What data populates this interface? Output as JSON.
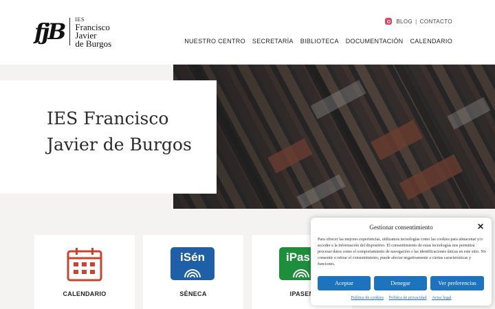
{
  "header": {
    "logo_mark": "fjB",
    "logo_small": "IES",
    "logo_line1": "Francisco",
    "logo_line2": "Javier",
    "logo_line3": "de Burgos",
    "top_links": {
      "blog": "BLOG",
      "separator": "|",
      "contact": "CONTACTO"
    },
    "nav": [
      "NUESTRO CENTRO",
      "SECRETARÍA",
      "BIBLIOTECA",
      "DOCUMENTACIÓN",
      "CALENDARIO"
    ]
  },
  "hero": {
    "title_line1": "IES Francisco",
    "title_line2": "Javier de Burgos"
  },
  "cards": [
    {
      "label": "CALENDARIO",
      "icon": "calendar-icon"
    },
    {
      "label": "SÉNECA",
      "icon_text": "iSén"
    },
    {
      "label": "IPASEN",
      "icon_text": "iPas"
    }
  ],
  "consent": {
    "title": "Gestionar consentimiento",
    "body": "Para ofrecer las mejores experiencias, utilizamos tecnologías como las cookies para almacenar y/o acceder a la información del dispositivo. El consentimiento de estas tecnologías nos permitirá procesar datos como el comportamiento de navegación o las identificaciones únicas en este sitio. No consentir o retirar el consentimiento, puede afectar negativamente a ciertas características y funciones.",
    "accept": "Aceptar",
    "deny": "Denegar",
    "preferences": "Ver preferencias",
    "links": [
      "Política de cookies",
      "Política de privacidad",
      "Aviso legal"
    ]
  },
  "colors": {
    "accent_blue": "#1e73be",
    "calendar_red": "#c9432d",
    "seneca_blue": "#1f5fa8",
    "ipasen_green": "#1d8f3c",
    "instagram": "#e4405f"
  }
}
